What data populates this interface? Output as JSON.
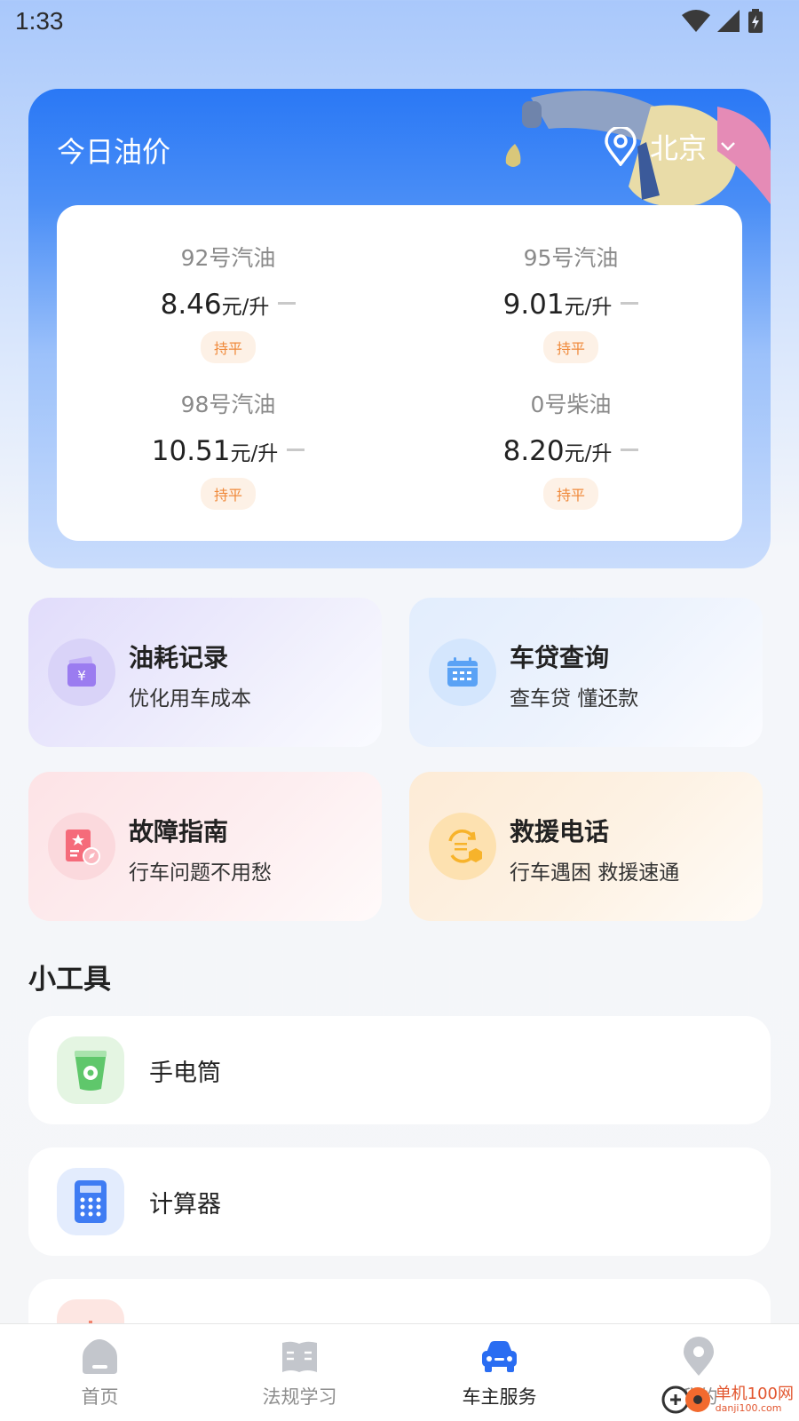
{
  "status_bar": {
    "time": "1:33"
  },
  "oil_card": {
    "title": "今日油价",
    "city": "北京",
    "fuels": [
      {
        "name": "92号汽油",
        "price": "8.46",
        "unit": "元/升",
        "trend": "持平"
      },
      {
        "name": "95号汽油",
        "price": "9.01",
        "unit": "元/升",
        "trend": "持平"
      },
      {
        "name": "98号汽油",
        "price": "10.51",
        "unit": "元/升",
        "trend": "持平"
      },
      {
        "name": "0号柴油",
        "price": "8.20",
        "unit": "元/升",
        "trend": "持平"
      }
    ]
  },
  "services": [
    {
      "title": "油耗记录",
      "subtitle": "优化用车成本",
      "icon": "wallet-icon",
      "color": "#9b7cf0"
    },
    {
      "title": "车贷查询",
      "subtitle": "查车贷 懂还款",
      "icon": "calendar-icon",
      "color": "#5aa2f5"
    },
    {
      "title": "故障指南",
      "subtitle": "行车问题不用愁",
      "icon": "guide-icon",
      "color": "#f56b7a"
    },
    {
      "title": "救援电话",
      "subtitle": "行车遇困 救援速通",
      "icon": "rescue-icon",
      "color": "#f7b32b"
    }
  ],
  "tools": {
    "title": "小工具",
    "items": [
      {
        "label": "手电筒",
        "icon": "flashlight-icon"
      },
      {
        "label": "计算器",
        "icon": "calculator-icon"
      },
      {
        "label": "",
        "icon": "chart-icon"
      }
    ]
  },
  "bottom_nav": {
    "items": [
      {
        "label": "首页",
        "icon": "home-icon"
      },
      {
        "label": "法规学习",
        "icon": "book-icon"
      },
      {
        "label": "车主服务",
        "icon": "car-icon",
        "active": true
      },
      {
        "label": "我的",
        "icon": "profile-icon"
      }
    ]
  },
  "watermark": {
    "text": "单机100网",
    "url": "danji100.com"
  },
  "colors": {
    "primary_blue": "#2a78f5",
    "badge_orange": "#f08a3c",
    "active_nav": "#2a6df2"
  }
}
